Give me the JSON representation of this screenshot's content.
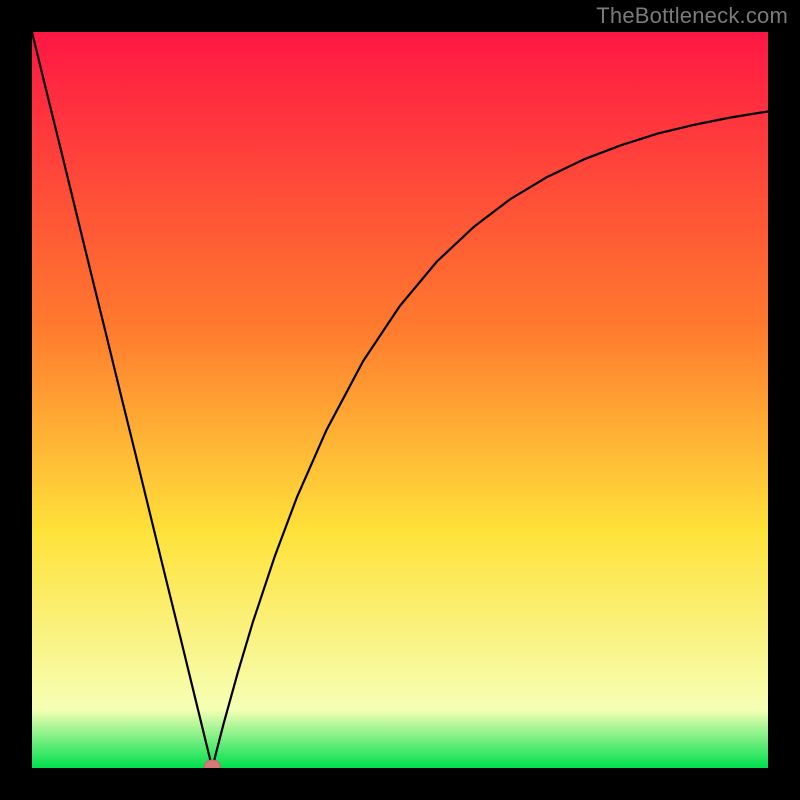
{
  "watermark": "TheBottleneck.com",
  "colors": {
    "frame": "#000000",
    "curve": "#000000",
    "marker_fill": "#d47a7a",
    "marker_stroke": "#c46868",
    "grad_top": "#ff1744",
    "grad_orange": "#ff7a2e",
    "grad_yellow": "#ffe23a",
    "grad_pale": "#f6ffb5",
    "grad_green": "#00e04e"
  },
  "chart_data": {
    "type": "line",
    "x": [
      0.0,
      0.02,
      0.04,
      0.06,
      0.08,
      0.1,
      0.12,
      0.14,
      0.16,
      0.18,
      0.2,
      0.22,
      0.24,
      0.245,
      0.25,
      0.26,
      0.28,
      0.3,
      0.33,
      0.36,
      0.4,
      0.45,
      0.5,
      0.55,
      0.6,
      0.65,
      0.7,
      0.75,
      0.8,
      0.85,
      0.9,
      0.95,
      1.0
    ],
    "y": [
      1.0,
      0.918,
      0.837,
      0.755,
      0.673,
      0.592,
      0.51,
      0.429,
      0.347,
      0.265,
      0.184,
      0.102,
      0.02,
      0.0,
      0.02,
      0.059,
      0.131,
      0.198,
      0.288,
      0.368,
      0.459,
      0.553,
      0.628,
      0.688,
      0.735,
      0.773,
      0.803,
      0.827,
      0.846,
      0.862,
      0.874,
      0.884,
      0.892
    ],
    "xlim": [
      0,
      1
    ],
    "ylim": [
      0,
      1
    ],
    "marker": {
      "x": 0.245,
      "y": 0.0
    },
    "title": "",
    "xlabel": "",
    "ylabel": ""
  }
}
